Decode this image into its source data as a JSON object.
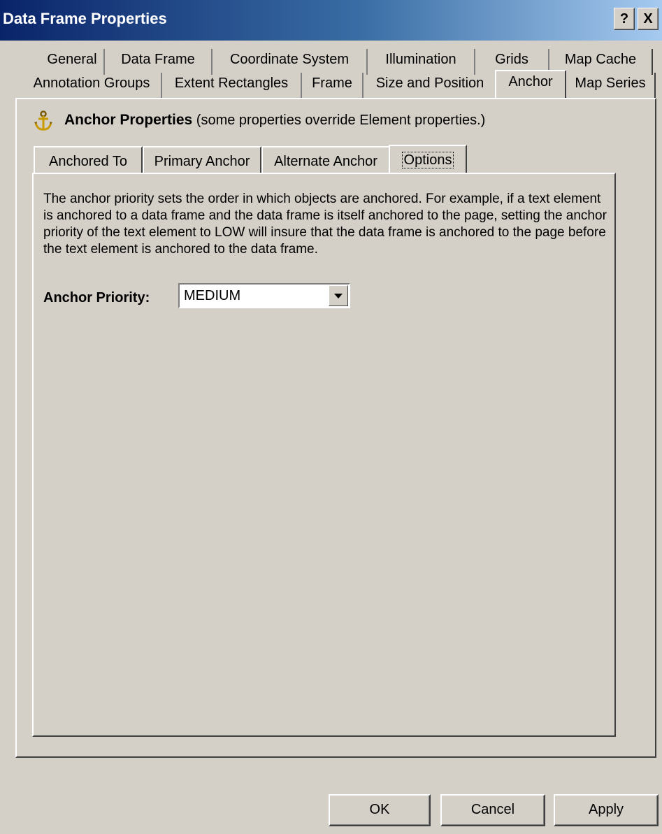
{
  "window": {
    "title": "Data Frame Properties",
    "help_label": "?",
    "close_label": "X"
  },
  "tabs": {
    "row_back": [
      "General",
      "Data Frame",
      "Coordinate System",
      "Illumination",
      "Grids",
      "Map Cache"
    ],
    "row_front": [
      "Annotation Groups",
      "Extent Rectangles",
      "Frame",
      "Size and Position",
      "Anchor",
      "Map Series"
    ],
    "active": "Anchor"
  },
  "section": {
    "title": "Anchor Properties",
    "subtitle": "(some properties override Element properties.)",
    "icon": "anchor-icon"
  },
  "inner_tabs": {
    "items": [
      "Anchored To",
      "Primary Anchor",
      "Alternate Anchor",
      "Options"
    ],
    "active": "Options"
  },
  "options": {
    "description": "The anchor priority sets the order in which objects are anchored.  For example, if a text element is anchored to a data frame and the data frame is itself anchored to the page, setting the anchor priority of the text element to LOW will insure that the data frame is anchored to the page before the text element is anchored to the data frame.",
    "priority_label": "Anchor Priority:",
    "priority_value": "MEDIUM"
  },
  "buttons": {
    "ok": "OK",
    "cancel": "Cancel",
    "apply": "Apply"
  },
  "colors": {
    "face": "#d4d0c8",
    "title_start": "#0a246a",
    "title_end": "#a6caf0"
  }
}
